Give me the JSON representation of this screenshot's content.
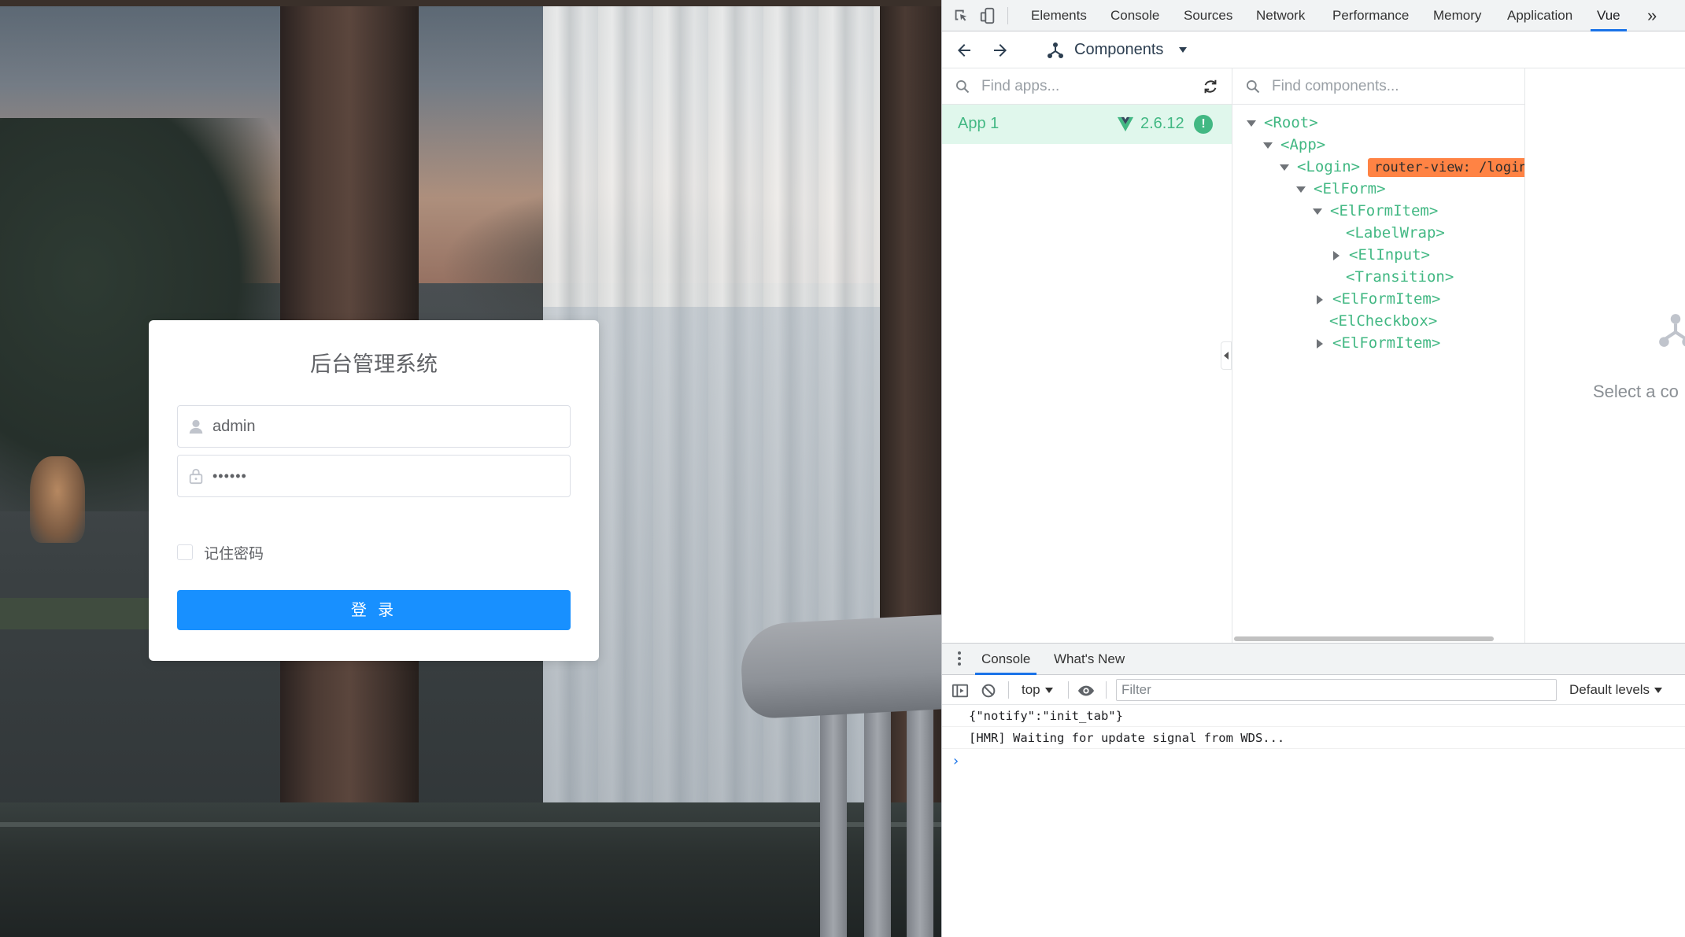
{
  "login": {
    "title": "后台管理系统",
    "username_value": "admin",
    "password_mask": "••••••",
    "remember_label": "记住密码",
    "submit_label": "登 录"
  },
  "devtools": {
    "tabs": [
      "Elements",
      "Console",
      "Sources",
      "Network",
      "Performance",
      "Memory",
      "Application",
      "Vue"
    ],
    "active_tab": "Vue",
    "more_label": "»",
    "vue_bar": {
      "components_label": "Components"
    },
    "apps": {
      "search_placeholder": "Find apps...",
      "items": [
        {
          "name": "App 1",
          "version": "2.6.12",
          "badge": "!"
        }
      ]
    },
    "components": {
      "search_placeholder": "Find components...",
      "tree": [
        {
          "label": "<Root>",
          "state": "expanded",
          "depth": 0
        },
        {
          "label": "<App>",
          "state": "expanded",
          "depth": 1
        },
        {
          "label": "<Login>",
          "state": "expanded",
          "depth": 2,
          "tag": "router-view: /login"
        },
        {
          "label": "<ElForm>",
          "state": "expanded",
          "depth": 3
        },
        {
          "label": "<ElFormItem>",
          "state": "expanded",
          "depth": 4
        },
        {
          "label": "<LabelWrap>",
          "state": "leaf",
          "depth": 5
        },
        {
          "label": "<ElInput>",
          "state": "collapsed",
          "depth": 5
        },
        {
          "label": "<Transition>",
          "state": "leaf",
          "depth": 5
        },
        {
          "label": "<ElFormItem>",
          "state": "collapsed",
          "depth": 4
        },
        {
          "label": "<ElCheckbox>",
          "state": "leaf",
          "depth": 4
        },
        {
          "label": "<ElFormItem>",
          "state": "collapsed",
          "depth": 4
        }
      ]
    },
    "detail": {
      "placeholder": "Select a co"
    },
    "drawer": {
      "tabs": [
        "Console",
        "What's New"
      ],
      "active_tab": "Console",
      "context": "top",
      "filter_placeholder": "Filter",
      "levels_label": "Default levels",
      "logs": [
        "{\"notify\":\"init_tab\"}",
        "[HMR] Waiting for update signal from WDS..."
      ],
      "prompt": "›"
    }
  },
  "colors": {
    "vue_green": "#42b883",
    "primary_blue": "#1890ff",
    "route_tag": "#ff8344",
    "devtools_accent": "#1a73e8"
  }
}
